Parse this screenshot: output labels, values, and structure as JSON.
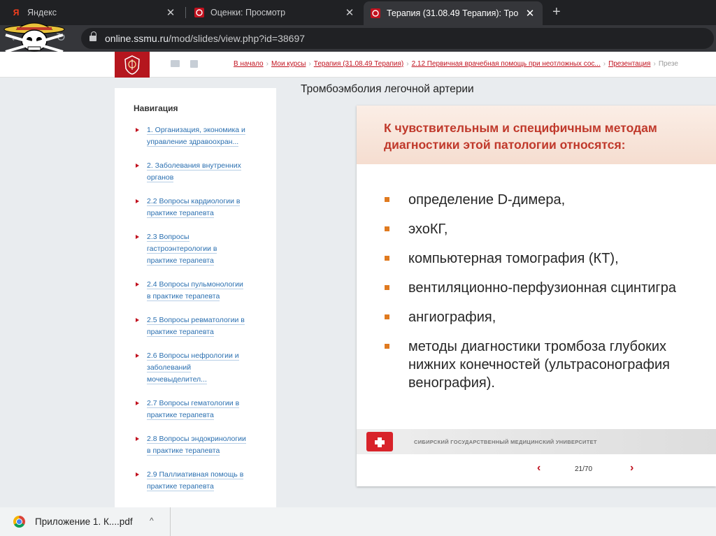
{
  "browser": {
    "tabs": [
      {
        "title": "Яндекс",
        "icon": "yandex-icon",
        "glyph": "Я",
        "active": false
      },
      {
        "title": "Оценки: Просмотр",
        "icon": "ssmu-crest-icon",
        "glyph": "",
        "active": false
      },
      {
        "title": "Терапия (31.08.49 Терапия): Тро",
        "icon": "ssmu-crest-icon",
        "glyph": "",
        "active": true
      }
    ],
    "close_glyph": "✕",
    "new_tab_glyph": "+",
    "back_glyph": "←",
    "reload_glyph": "↻",
    "url_host": "online.ssmu.ru",
    "url_path": "/mod/slides/view.php?id=38697"
  },
  "breadcrumb": {
    "items": [
      "В начало",
      "Мои курсы",
      "Терапия (31.08.49 Терапия)",
      "2.12 Первичная врачебная помощь при неотложных сос...",
      "Презентация",
      "Презе"
    ],
    "separator": "›"
  },
  "sidebar": {
    "heading": "Навигация",
    "items": [
      {
        "lines": [
          "1. Организация, экономика и",
          "управление здравоохран..."
        ]
      },
      {
        "lines": [
          "2. Заболевания внутренних",
          "органов"
        ]
      },
      {
        "lines": [
          "2.2 Вопросы кардиологии в",
          "практике терапевта"
        ]
      },
      {
        "lines": [
          "2.3 Вопросы",
          "гастроэнтерологии в",
          "практике терапевта"
        ]
      },
      {
        "lines": [
          "2.4 Вопросы пульмонологии",
          "в практике терапевта"
        ]
      },
      {
        "lines": [
          "2.5 Вопросы ревматологии в",
          "практике терапевта"
        ]
      },
      {
        "lines": [
          "2.6 Вопросы нефрологии и",
          "заболеваний",
          "мочевыделител..."
        ]
      },
      {
        "lines": [
          "2.7 Вопросы гематологии в",
          "практике терапевта"
        ]
      },
      {
        "lines": [
          "2.8 Вопросы эндокринологии",
          "в практике терапевта"
        ]
      },
      {
        "lines": [
          "2.9 Паллиативная помощь в",
          "практике терапевта"
        ]
      }
    ]
  },
  "main": {
    "title": "Тромбоэмболия легочной артерии",
    "slide": {
      "heading_lines": [
        "К чувствительным и специфичным методам",
        "диагностики этой патологии относятся:"
      ],
      "bullets": [
        {
          "lines": [
            "определение D-димера,"
          ]
        },
        {
          "lines": [
            "эхоКГ,"
          ]
        },
        {
          "lines": [
            "компьютерная томография (КТ),"
          ]
        },
        {
          "lines": [
            "вентиляционно-перфузионная сцинтигра"
          ]
        },
        {
          "lines": [
            "ангиография,"
          ]
        },
        {
          "lines": [
            "методы диагностики тромбоза глубоких",
            "нижних конечностей (ультрасонография",
            "венография)."
          ]
        }
      ],
      "footer_text": "СИБИРСКИЙ ГОСУДАРСТВЕННЫЙ МЕДИЦИНСКИЙ УНИВЕРСИТЕТ"
    },
    "pager": {
      "prev_glyph": "‹",
      "next_glyph": "›",
      "current": 21,
      "total": 70,
      "label": "21/70"
    }
  },
  "downloads": {
    "file_name": "Приложение 1. К....pdf",
    "caret_glyph": "^"
  },
  "colors": {
    "accent": "#c1121f",
    "bullet": "#e07a1f",
    "slide_heading": "#c0392b",
    "link": "#2a6fb0"
  }
}
